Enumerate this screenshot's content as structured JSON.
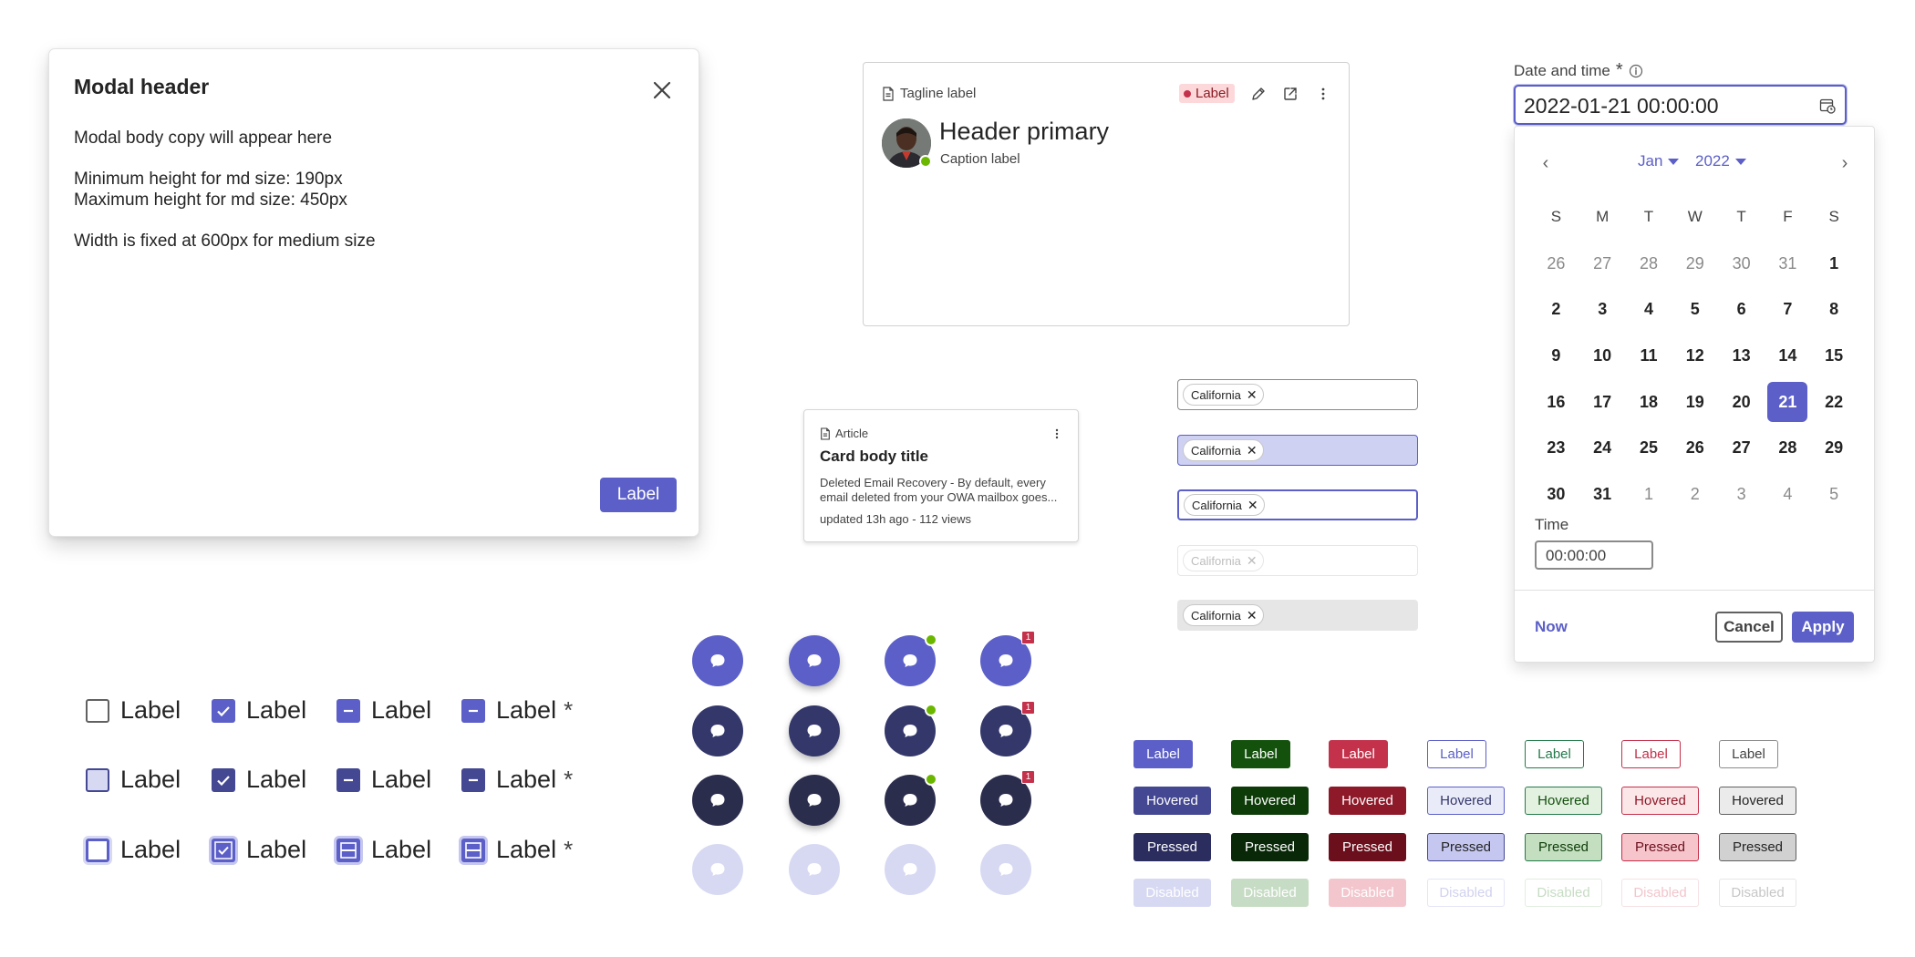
{
  "modal": {
    "title": "Modal header",
    "body": [
      "Modal body copy will appear here",
      "Minimum height for md size: 190px",
      "Maximum height for md size: 450px",
      "Width is fixed at 600px for medium size"
    ],
    "button_label": "Label",
    "close_icon": "close-icon"
  },
  "profile_card": {
    "tagline": "Tagline label",
    "badge": "Label",
    "title": "Header primary",
    "caption": "Caption label",
    "icons": [
      "document-icon",
      "edit-icon",
      "open-external-icon",
      "more-vertical-icon"
    ],
    "presence": "available"
  },
  "article_card": {
    "tag": "Article",
    "title": "Card body title",
    "description": "Deleted Email Recovery - By default, every email deleted from your OWA mailbox goes...",
    "meta": "updated 13h ago - 112 views"
  },
  "tag_pickers": {
    "tag": "California",
    "states": [
      "rest",
      "hover",
      "focus",
      "disabled",
      "filled"
    ]
  },
  "date_time": {
    "label": "Date and time",
    "required_mark": "*",
    "value": "2022-01-21 00:00:00",
    "month": "Jan",
    "year": "2022",
    "weekdays": [
      "S",
      "M",
      "T",
      "W",
      "T",
      "F",
      "S"
    ],
    "days": [
      [
        "26",
        "out"
      ],
      [
        "27",
        "out"
      ],
      [
        "28",
        "out"
      ],
      [
        "29",
        "out"
      ],
      [
        "30",
        "out"
      ],
      [
        "31",
        "out"
      ],
      [
        "1",
        "in"
      ],
      [
        "2",
        "in"
      ],
      [
        "3",
        "in"
      ],
      [
        "4",
        "in"
      ],
      [
        "5",
        "in"
      ],
      [
        "6",
        "in"
      ],
      [
        "7",
        "in"
      ],
      [
        "8",
        "in"
      ],
      [
        "9",
        "in"
      ],
      [
        "10",
        "in"
      ],
      [
        "11",
        "in"
      ],
      [
        "12",
        "in"
      ],
      [
        "13",
        "in"
      ],
      [
        "14",
        "in"
      ],
      [
        "15",
        "in"
      ],
      [
        "16",
        "in"
      ],
      [
        "17",
        "in"
      ],
      [
        "18",
        "in"
      ],
      [
        "19",
        "in"
      ],
      [
        "20",
        "in"
      ],
      [
        "21",
        "sel"
      ],
      [
        "22",
        "in"
      ],
      [
        "23",
        "in"
      ],
      [
        "24",
        "in"
      ],
      [
        "25",
        "in"
      ],
      [
        "26",
        "in"
      ],
      [
        "27",
        "in"
      ],
      [
        "28",
        "in"
      ],
      [
        "29",
        "in"
      ],
      [
        "30",
        "in"
      ],
      [
        "31",
        "in"
      ],
      [
        "1",
        "out"
      ],
      [
        "2",
        "out"
      ],
      [
        "3",
        "out"
      ],
      [
        "4",
        "out"
      ],
      [
        "5",
        "out"
      ]
    ],
    "time_label": "Time",
    "time_value": "00:00:00",
    "now_label": "Now",
    "cancel_label": "Cancel",
    "apply_label": "Apply"
  },
  "checkboxes": {
    "label": "Label",
    "required_mark": "*",
    "rows": [
      "rest",
      "hover",
      "focus"
    ],
    "kinds": [
      "unchecked",
      "checked",
      "indeterminate",
      "indeterminate-required"
    ]
  },
  "chat_buttons": {
    "rows": [
      "rest",
      "hover",
      "pressed",
      "disabled"
    ],
    "variants": [
      "plain",
      "shadow",
      "presence",
      "badge"
    ],
    "badge_count": "1",
    "icon": "chat-icon"
  },
  "button_matrix": {
    "rows": [
      "Label",
      "Hovered",
      "Pressed",
      "Disabled"
    ],
    "colors": {
      "brand": "#5b5fc7",
      "success": "#237b4b",
      "danger": "#c4314b",
      "neutral": "#616161"
    }
  }
}
